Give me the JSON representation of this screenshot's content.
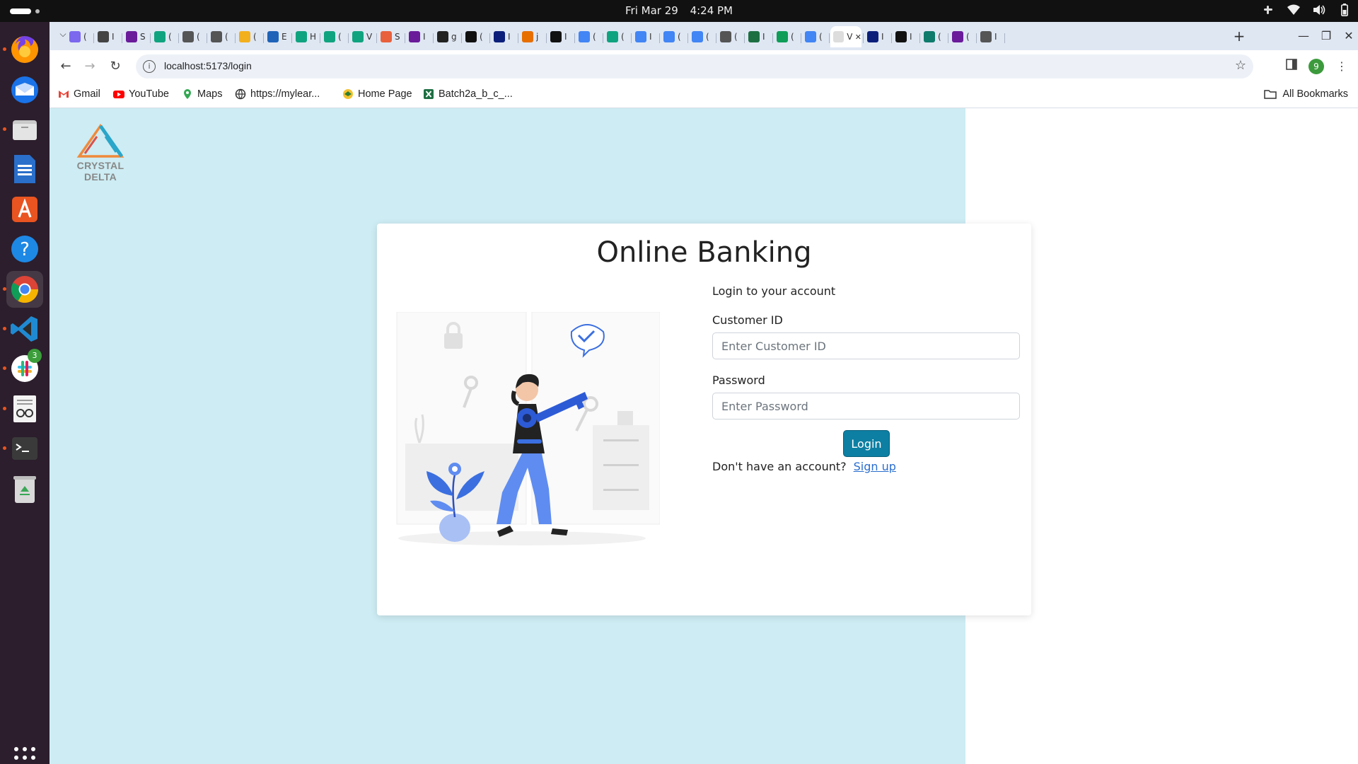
{
  "system_bar": {
    "date": "Fri Mar 29",
    "time": "4:24 PM"
  },
  "dock": {
    "items": [
      {
        "name": "Firefox",
        "icon": "firefox-icon"
      },
      {
        "name": "Thunderbird",
        "icon": "thunderbird-icon"
      },
      {
        "name": "Files",
        "icon": "files-icon"
      },
      {
        "name": "LibreOffice Writer",
        "icon": "writer-icon"
      },
      {
        "name": "App Center",
        "icon": "app-center-icon"
      },
      {
        "name": "Help",
        "icon": "help-icon"
      },
      {
        "name": "Google Chrome",
        "icon": "chrome-icon"
      },
      {
        "name": "Visual Studio Code",
        "icon": "vscode-icon"
      },
      {
        "name": "Slack",
        "icon": "slack-icon",
        "badge": "3"
      },
      {
        "name": "Document Viewer",
        "icon": "document-viewer-icon"
      },
      {
        "name": "Terminal",
        "icon": "terminal-icon"
      },
      {
        "name": "Trash",
        "icon": "trash-icon"
      }
    ]
  },
  "browser": {
    "tabs": [
      {
        "title": "(",
        "color": "#7b68ee"
      },
      {
        "title": "I",
        "color": "#444444"
      },
      {
        "title": "S",
        "color": "#6a1b9a"
      },
      {
        "title": "(",
        "color": "#10a37f"
      },
      {
        "title": "(",
        "color": "#555555"
      },
      {
        "title": "(",
        "color": "#555555"
      },
      {
        "title": "(",
        "color": "#f2b01e"
      },
      {
        "title": "E",
        "color": "#1e63b8"
      },
      {
        "title": "H",
        "color": "#10a37f"
      },
      {
        "title": "(",
        "color": "#10a37f"
      },
      {
        "title": "V",
        "color": "#10a37f"
      },
      {
        "title": "S",
        "color": "#e8613c"
      },
      {
        "title": "I",
        "color": "#6a1b9a"
      },
      {
        "title": "g",
        "color": "#222222"
      },
      {
        "title": "(",
        "color": "#111111"
      },
      {
        "title": "I",
        "color": "#0b1f7a"
      },
      {
        "title": "j",
        "color": "#e76f00"
      },
      {
        "title": "I",
        "color": "#111111"
      },
      {
        "title": "(",
        "color": "#4285f4"
      },
      {
        "title": "(",
        "color": "#10a37f"
      },
      {
        "title": "I",
        "color": "#4285f4"
      },
      {
        "title": "(",
        "color": "#4285f4"
      },
      {
        "title": "(",
        "color": "#4285f4"
      },
      {
        "title": "(",
        "color": "#555555"
      },
      {
        "title": "I",
        "color": "#1d6f42"
      },
      {
        "title": "(",
        "color": "#0f9d58"
      },
      {
        "title": "(",
        "color": "#4285f4"
      },
      {
        "title": "V",
        "color": "#ffffff",
        "active": true
      },
      {
        "title": "I",
        "color": "#0b1f7a"
      },
      {
        "title": "I",
        "color": "#111111"
      },
      {
        "title": "(",
        "color": "#0f7b6c"
      },
      {
        "title": "(",
        "color": "#6a1b9a"
      },
      {
        "title": "I",
        "color": "#555555"
      }
    ],
    "url": "localhost:5173/login",
    "profile_initial": "9",
    "bookmarks": [
      {
        "label": "Gmail",
        "icon": "gmail-icon"
      },
      {
        "label": "YouTube",
        "icon": "youtube-icon"
      },
      {
        "label": "Maps",
        "icon": "maps-icon"
      },
      {
        "label": "https://mylear...",
        "icon": "globe-icon"
      },
      {
        "label": "Home Page",
        "icon": "home-page-icon"
      },
      {
        "label": "Batch2a_b_c_...",
        "icon": "excel-icon"
      }
    ],
    "all_bookmarks_label": "All Bookmarks"
  },
  "page": {
    "logo_text": "CRYSTAL DELTA",
    "title": "Online Banking",
    "form": {
      "heading": "Login to your account",
      "customer_id_label": "Customer ID",
      "customer_id_placeholder": "Enter Customer ID",
      "password_label": "Password",
      "password_placeholder": "Enter Password",
      "login_label": "Login",
      "no_account_text": "Don't have an account?",
      "signup_label": "Sign up"
    }
  },
  "colors": {
    "page_background": "#cdecf3",
    "login_button": "#0d7fa3",
    "link": "#2a6ecf"
  }
}
